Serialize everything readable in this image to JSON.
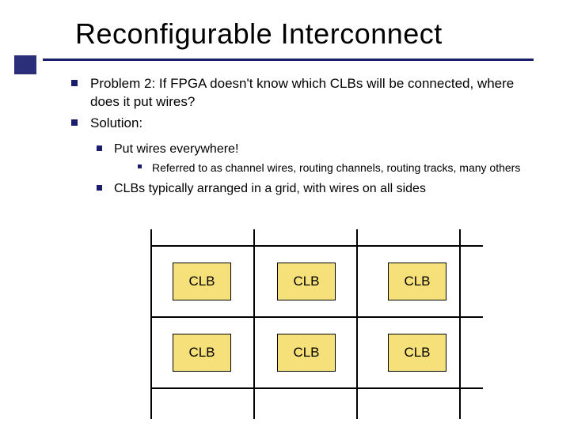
{
  "title": "Reconfigurable Interconnect",
  "bullets": {
    "problem": "Problem 2: If FPGA doesn't know which CLBs will be connected, where does it put wires?",
    "solution": "Solution:",
    "sub1": "Put wires everywhere!",
    "sub1a": "Referred to as channel wires, routing channels, routing tracks, many others",
    "sub2": "CLBs typically arranged in a grid, with wires on all sides"
  },
  "clb_label": "CLB",
  "grid": {
    "rows": 2,
    "cols": 3
  }
}
